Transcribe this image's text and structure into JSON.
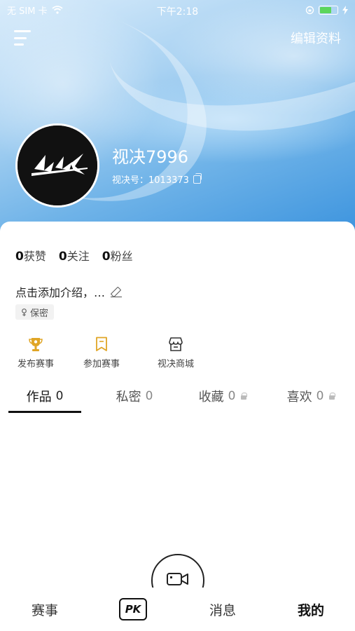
{
  "status_bar": {
    "carrier": "无 SIM 卡",
    "time": "下午2:18"
  },
  "topbar": {
    "menu_icon": "menu-icon",
    "edit_label": "编辑资料"
  },
  "profile": {
    "avatar_text": "LLX",
    "name": "视决7996",
    "id_label": "视决号：1013373"
  },
  "stats": [
    {
      "count": "0",
      "label": "获赞"
    },
    {
      "count": "0",
      "label": "关注"
    },
    {
      "count": "0",
      "label": "粉丝"
    }
  ],
  "bio": {
    "placeholder": "点击添加介绍，…",
    "gender": "保密"
  },
  "actions": [
    {
      "label": "发布赛事",
      "icon": "trophy-icon"
    },
    {
      "label": "参加赛事",
      "icon": "bookmark-icon"
    },
    {
      "label": "视决商城",
      "icon": "store-icon"
    }
  ],
  "tabs": [
    {
      "label": "作品",
      "count": "0",
      "locked": false,
      "active": true
    },
    {
      "label": "私密",
      "count": "0",
      "locked": false,
      "active": false
    },
    {
      "label": "收藏",
      "count": "0",
      "locked": true,
      "active": false
    },
    {
      "label": "喜欢",
      "count": "0",
      "locked": true,
      "active": false
    }
  ],
  "bottom_nav": [
    {
      "label": "赛事",
      "active": false
    },
    {
      "label": "PK",
      "icon": "pk-icon",
      "active": false
    },
    {
      "label": "消息",
      "active": false
    },
    {
      "label": "我的",
      "active": true
    }
  ],
  "colors": {
    "header_blue": "#3b93de",
    "battery_green": "#5cd65c",
    "trophy_gold": "#e0a526"
  }
}
